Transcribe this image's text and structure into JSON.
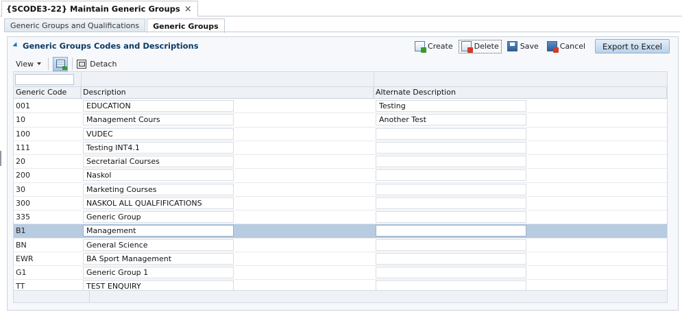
{
  "document_tab": {
    "title": "{SCODE3-22} Maintain Generic Groups",
    "close": "×"
  },
  "subtabs": [
    {
      "label": "Generic Groups and Qualifications"
    },
    {
      "label": "Generic Groups"
    }
  ],
  "panel": {
    "title": "Generic Groups Codes and Descriptions"
  },
  "actions": {
    "create": "Create",
    "delete": "Delete",
    "save": "Save",
    "cancel": "Cancel",
    "export": "Export to Excel"
  },
  "toolbar": {
    "view": "View",
    "detach": "Detach"
  },
  "grid": {
    "filter_value": "",
    "columns": [
      "Generic Code",
      "Description",
      "Alternate Description"
    ],
    "rows": [
      {
        "code": "001",
        "description": "EDUCATION",
        "alternate": "Testing"
      },
      {
        "code": "10",
        "description": "Management Cours",
        "alternate": "Another Test"
      },
      {
        "code": "100",
        "description": "VUDEC",
        "alternate": ""
      },
      {
        "code": "111",
        "description": "Testing INT4.1",
        "alternate": ""
      },
      {
        "code": "20",
        "description": "Secretarial Courses",
        "alternate": ""
      },
      {
        "code": "200",
        "description": "Naskol",
        "alternate": ""
      },
      {
        "code": "30",
        "description": "Marketing Courses",
        "alternate": ""
      },
      {
        "code": "300",
        "description": "NASKOL ALL QUALFIFICATIONS",
        "alternate": ""
      },
      {
        "code": "335",
        "description": "Generic Group",
        "alternate": ""
      },
      {
        "code": "B1",
        "description": "Management",
        "alternate": "",
        "selected": true
      },
      {
        "code": "BN",
        "description": "General Science",
        "alternate": ""
      },
      {
        "code": "EWR",
        "description": "BA Sport Management",
        "alternate": ""
      },
      {
        "code": "G1",
        "description": "Generic Group 1",
        "alternate": ""
      },
      {
        "code": "TT",
        "description": "TEST ENQUIRY",
        "alternate": ""
      }
    ]
  },
  "colors": {
    "selected_row": "#b7cbe1",
    "title_text": "#0b3b66",
    "excel_button": "#b9d2ea"
  }
}
